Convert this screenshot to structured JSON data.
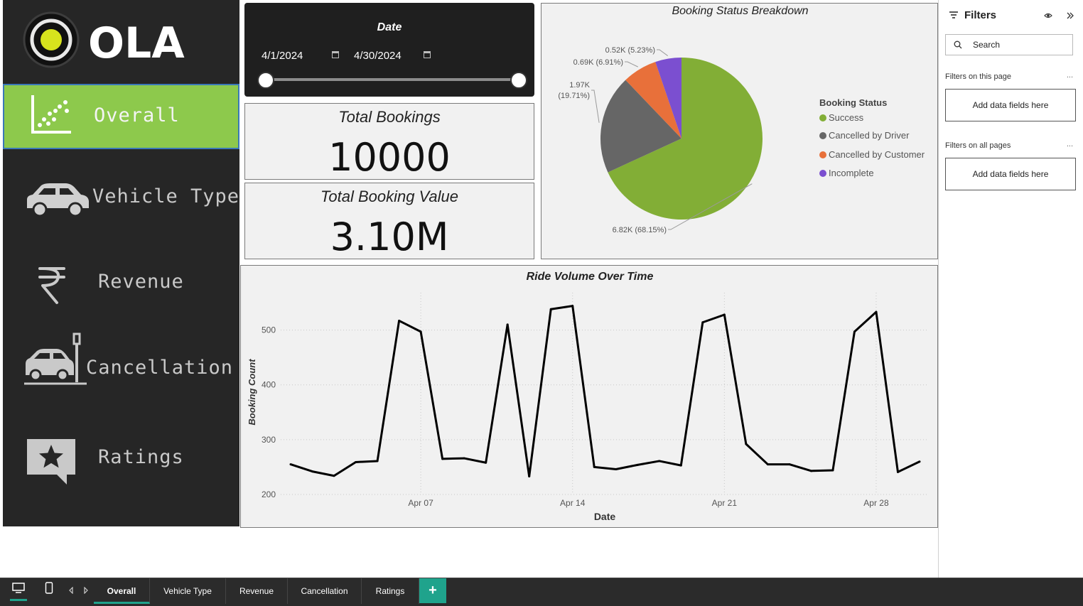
{
  "logo": {
    "text": "OLA"
  },
  "nav": {
    "items": [
      {
        "label": "Overall"
      },
      {
        "label": "Vehicle Type"
      },
      {
        "label": "Revenue"
      },
      {
        "label": "Cancellation"
      },
      {
        "label": "Ratings"
      }
    ]
  },
  "date_slicer": {
    "title": "Date",
    "start": "4/1/2024",
    "end": "4/30/2024"
  },
  "kpis": {
    "total_bookings": {
      "title": "Total Bookings",
      "value": "10000"
    },
    "total_value": {
      "title": "Total Booking Value",
      "value": "3.10M"
    }
  },
  "pie": {
    "title": "Booking Status Breakdown",
    "legend_title": "Booking Status",
    "slices": [
      {
        "name": "Success",
        "value": 6.82,
        "percent": 68.15,
        "label": "6.82K (68.15%)",
        "color": "#82ae36"
      },
      {
        "name": "Cancelled by Driver",
        "value": 1.97,
        "percent": 19.71,
        "label": "1.97K (19.71%)",
        "color": "#666666"
      },
      {
        "name": "Cancelled by Customer",
        "value": 0.69,
        "percent": 6.91,
        "label": "0.69K (6.91%)",
        "color": "#e8703a"
      },
      {
        "name": "Incomplete",
        "value": 0.52,
        "percent": 5.23,
        "label": "0.52K (5.23%)",
        "color": "#7b4fd0"
      }
    ]
  },
  "chart_data": {
    "type": "line",
    "title": "Ride Volume Over Time",
    "xlabel": "Date",
    "ylabel": "Booking Count",
    "ylim": [
      200,
      550
    ],
    "yticks": [
      200,
      300,
      400,
      500
    ],
    "xtick_labels": [
      "Apr 07",
      "Apr 14",
      "Apr 21",
      "Apr 28"
    ],
    "xtick_days": [
      7,
      14,
      21,
      28
    ],
    "grid": true,
    "series": [
      {
        "days": [
          1,
          2,
          3,
          4,
          5,
          6,
          7,
          8,
          9,
          10,
          11,
          12,
          13,
          14,
          15,
          16,
          17,
          18,
          19,
          20,
          21,
          22,
          23,
          24,
          25,
          26,
          27,
          28,
          29,
          30
        ],
        "values": [
          255,
          242,
          234,
          259,
          261,
          517,
          497,
          265,
          266,
          258,
          510,
          233,
          538,
          544,
          250,
          246,
          254,
          261,
          253,
          514,
          528,
          292,
          255,
          255,
          243,
          244,
          497,
          533,
          241,
          260
        ],
        "color": "#000000"
      }
    ]
  },
  "filters": {
    "title": "Filters",
    "search_placeholder": "Search",
    "this_page_label": "Filters on this page",
    "all_pages_label": "Filters on all pages",
    "add_fields": "Add data fields here",
    "more": "..."
  },
  "tabs": {
    "items": [
      {
        "label": "Overall"
      },
      {
        "label": "Vehicle Type"
      },
      {
        "label": "Revenue"
      },
      {
        "label": "Cancellation"
      },
      {
        "label": "Ratings"
      }
    ],
    "add": "+"
  }
}
